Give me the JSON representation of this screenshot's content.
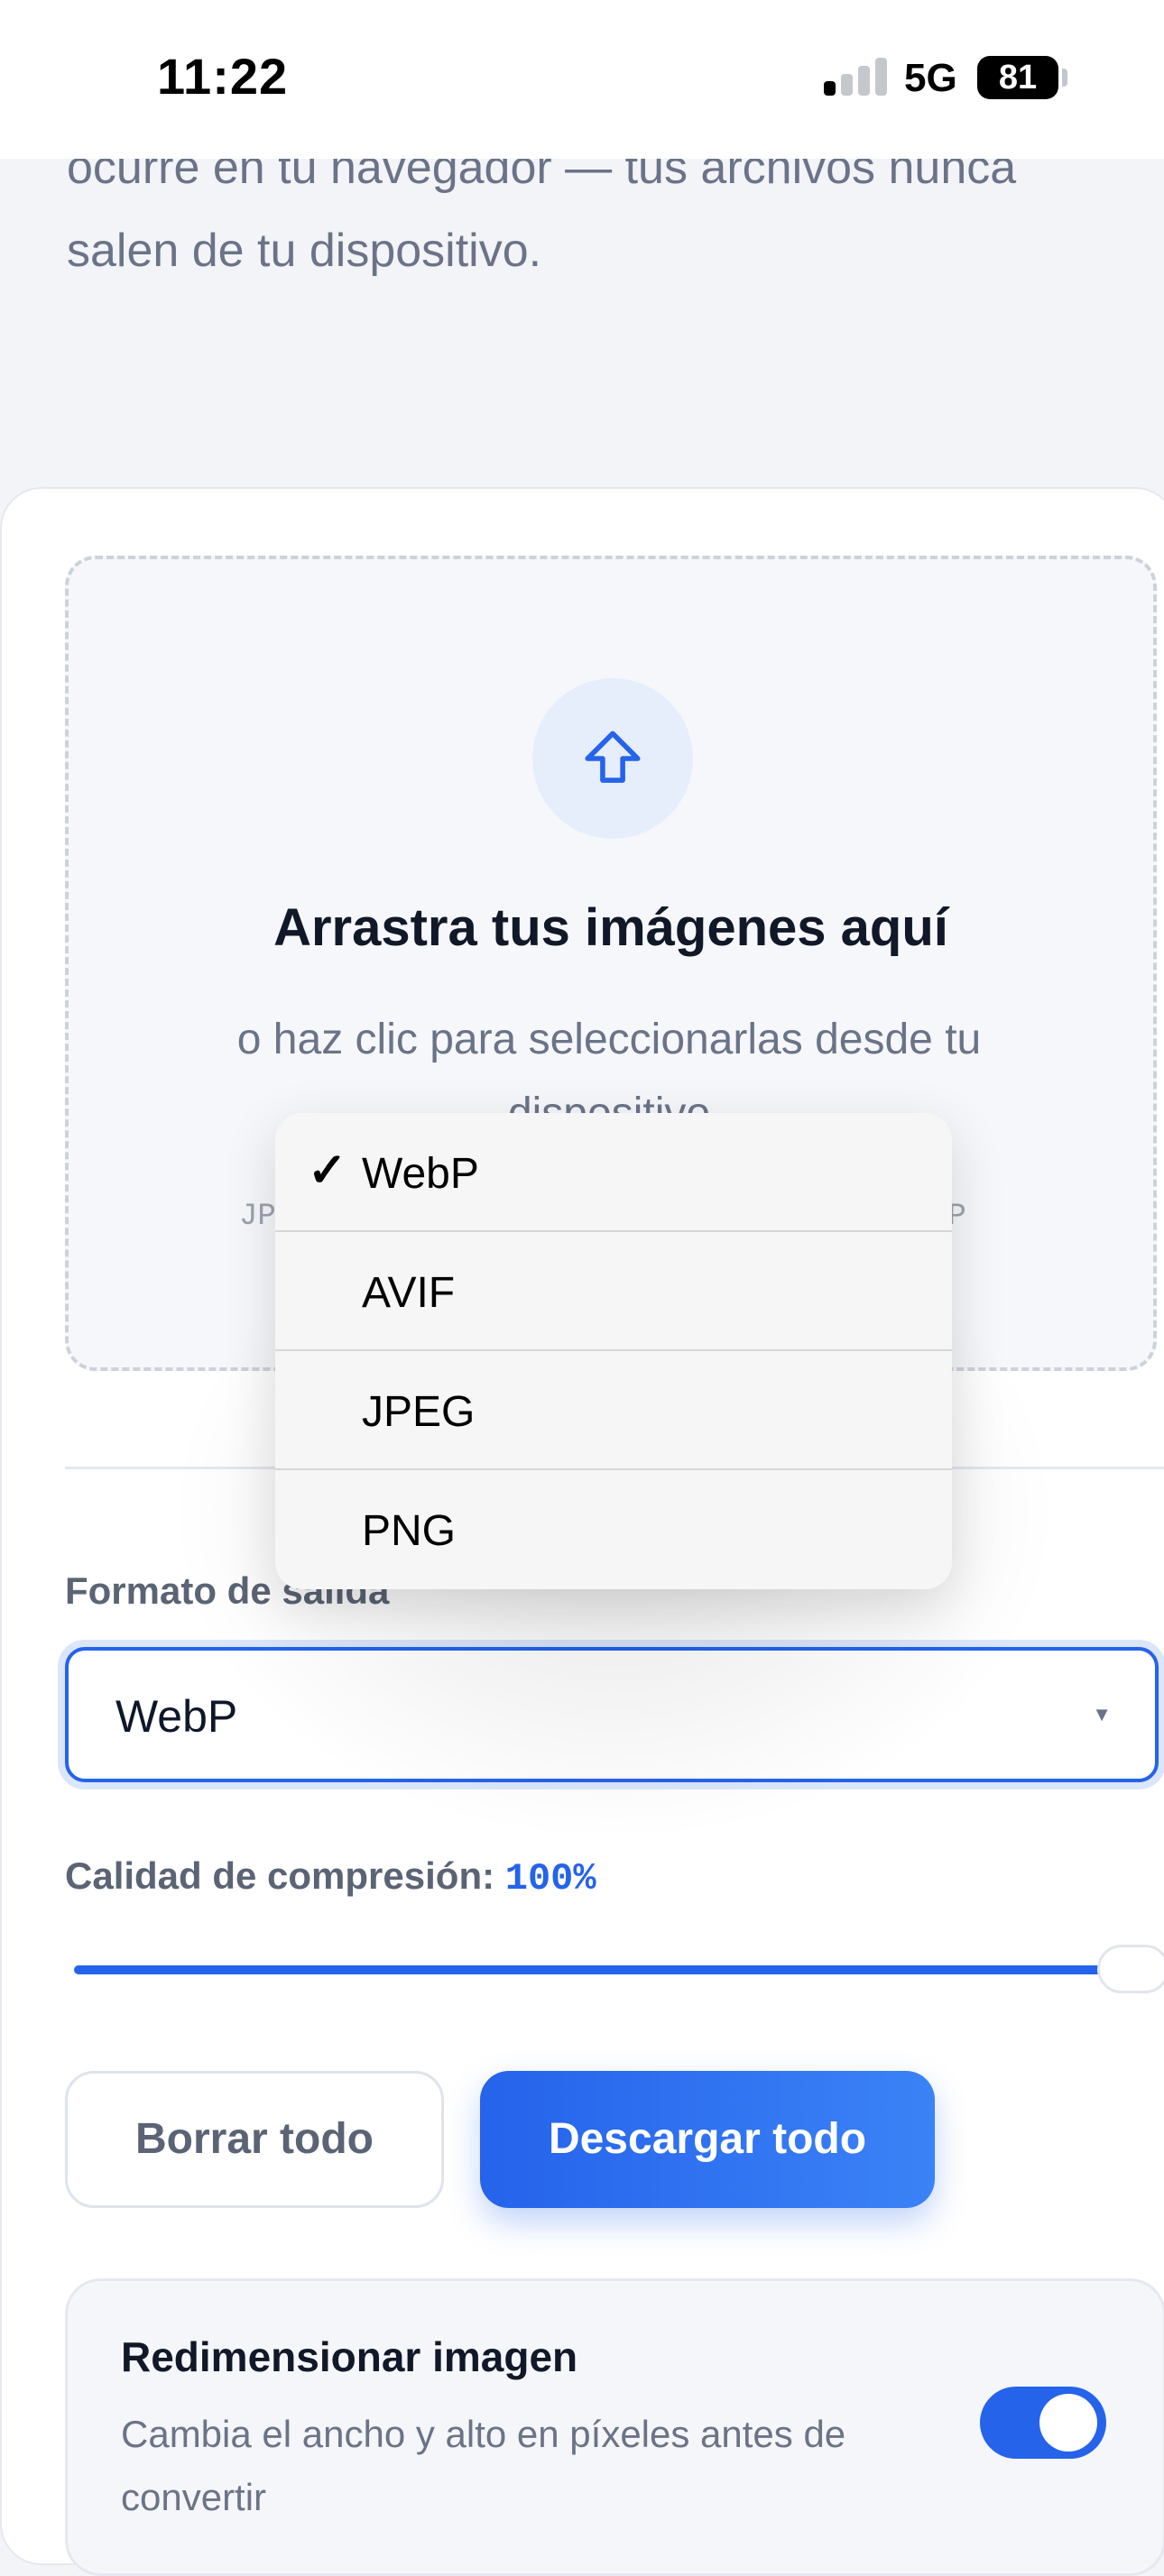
{
  "status_bar": {
    "time": "11:22",
    "network": "5G",
    "battery": "81"
  },
  "intro": {
    "text": "ocurre en tu navegador — tus archivos nunca salen de tu dispositivo."
  },
  "dropzone": {
    "icon": "upload-arrow-icon",
    "title": "Arrastra tus imágenes aquí",
    "subtitle": "o haz clic para seleccionarlas desde tu dispositivo",
    "formats_left": "JP",
    "formats_right": "MP"
  },
  "output_format": {
    "label": "Formato de salida",
    "selected": "WebP"
  },
  "quality": {
    "label": "Calidad de compresión:",
    "value": "100%",
    "level_percent": 100
  },
  "actions": {
    "clear_label": "Borrar todo",
    "download_label": "Descargar todo"
  },
  "resize": {
    "title": "Redimensionar imagen",
    "description": "Cambia el ancho y alto en píxeles antes de convertir",
    "enabled": true
  },
  "format_menu": {
    "check_mark": "✓",
    "options": [
      {
        "label": "WebP",
        "selected": true
      },
      {
        "label": "AVIF",
        "selected": false
      },
      {
        "label": "JPEG",
        "selected": false
      },
      {
        "label": "PNG",
        "selected": false
      }
    ]
  },
  "colors": {
    "accent": "#2563eb",
    "text_muted": "#6b7387"
  }
}
